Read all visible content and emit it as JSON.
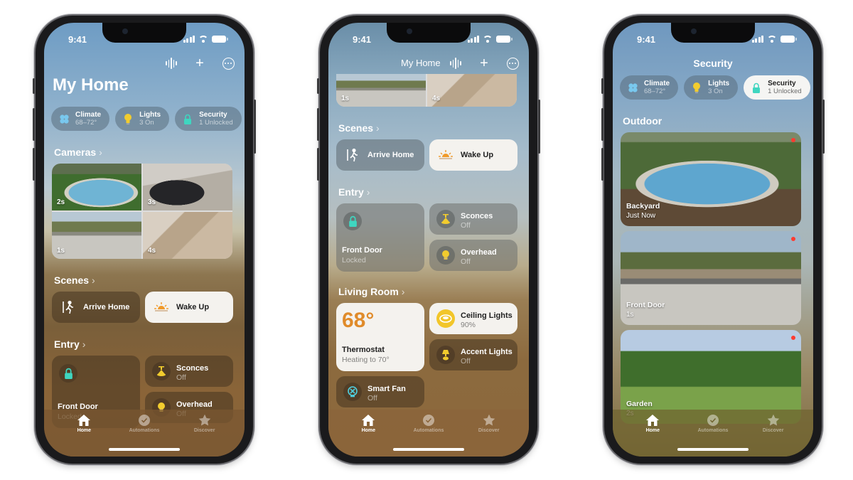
{
  "status": {
    "time": "9:41"
  },
  "phones": [
    {
      "title": "My Home",
      "chips": [
        {
          "label": "Climate",
          "sub": "68–72°",
          "icon": "fan-icon"
        },
        {
          "label": "Lights",
          "sub": "3 On",
          "icon": "lightbulb-icon"
        },
        {
          "label": "Security",
          "sub": "1 Unlocked",
          "icon": "lock-icon"
        }
      ],
      "cameras": {
        "heading": "Cameras",
        "tiles": [
          {
            "label": "2s"
          },
          {
            "label": "3s"
          },
          {
            "label": "1s"
          },
          {
            "label": "4s"
          }
        ]
      },
      "scenes": {
        "heading": "Scenes",
        "items": [
          {
            "label": "Arrive Home"
          },
          {
            "label": "Wake Up"
          }
        ]
      },
      "entry": {
        "heading": "Entry",
        "front_door": {
          "name": "Front Door",
          "state": "Locked"
        },
        "sconces": {
          "name": "Sconces",
          "state": "Off"
        },
        "overhead": {
          "name": "Overhead",
          "state": "Off"
        }
      }
    },
    {
      "nav_title": "My Home",
      "cameras": {
        "tiles": [
          {
            "label": "1s"
          },
          {
            "label": "4s"
          }
        ]
      },
      "scenes": {
        "heading": "Scenes",
        "items": [
          {
            "label": "Arrive Home"
          },
          {
            "label": "Wake Up"
          }
        ]
      },
      "entry": {
        "heading": "Entry",
        "front_door": {
          "name": "Front Door",
          "state": "Locked"
        },
        "sconces": {
          "name": "Sconces",
          "state": "Off"
        },
        "overhead": {
          "name": "Overhead",
          "state": "Off"
        }
      },
      "living_room": {
        "heading": "Living Room",
        "thermostat": {
          "temp": "68°",
          "name": "Thermostat",
          "state": "Heating to 70°"
        },
        "ceiling_lights": {
          "name": "Ceiling Lights",
          "state": "90%"
        },
        "accent_lights": {
          "name": "Accent Lights",
          "state": "Off"
        },
        "smart_fan": {
          "name": "Smart Fan",
          "state": "Off"
        }
      }
    },
    {
      "nav_title": "Security",
      "chips": [
        {
          "label": "Climate",
          "sub": "68–72°",
          "icon": "fan-icon"
        },
        {
          "label": "Lights",
          "sub": "3 On",
          "icon": "lightbulb-icon"
        },
        {
          "label": "Security",
          "sub": "1 Unlocked",
          "icon": "lock-icon",
          "selected": true
        }
      ],
      "outdoor": {
        "heading": "Outdoor",
        "cameras": [
          {
            "name": "Backyard",
            "time": "Just Now"
          },
          {
            "name": "Front Door",
            "time": "1s"
          },
          {
            "name": "Garden",
            "time": "2s"
          }
        ]
      }
    }
  ],
  "tabbar": {
    "items": [
      {
        "label": "Home",
        "active": true
      },
      {
        "label": "Automations"
      },
      {
        "label": "Discover"
      }
    ]
  },
  "colors": {
    "accent_temp": "#e08b2a",
    "lock_teal": "#3fd6c0",
    "bulb_yellow": "#f2cc2e",
    "rec_red": "#ff3b30"
  }
}
